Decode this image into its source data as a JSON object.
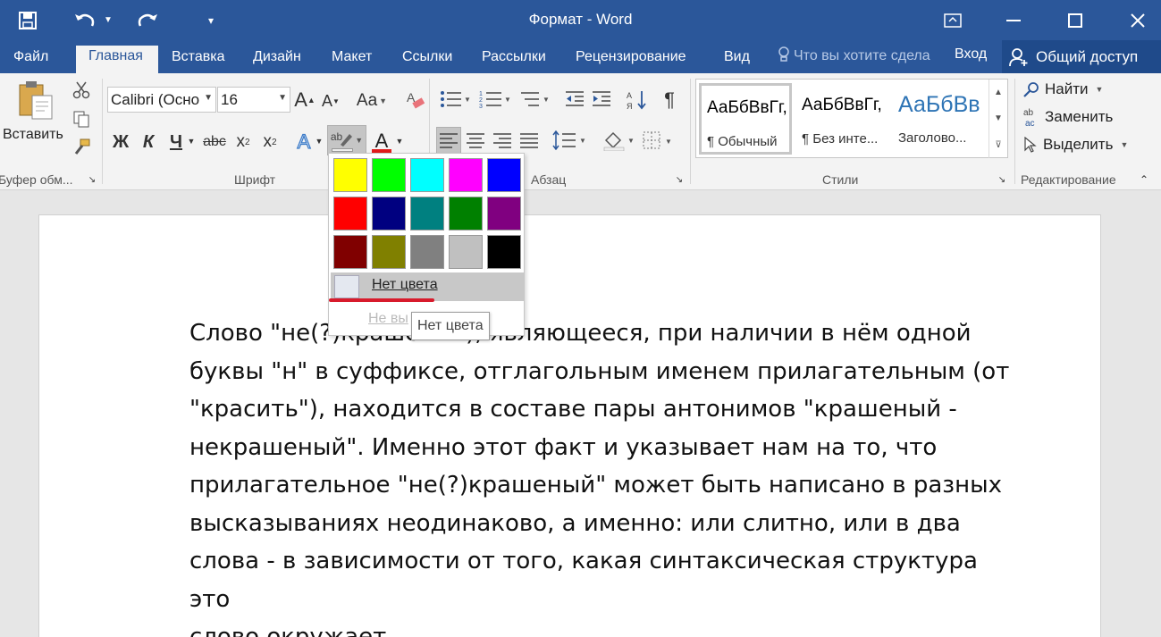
{
  "titlebar": {
    "title": "Формат - Word",
    "qat": [
      "save-icon",
      "undo-icon",
      "redo-icon",
      "customize-icon"
    ],
    "window_controls": [
      "ribbon-display-icon",
      "minimize-icon",
      "maximize-icon",
      "close-icon"
    ]
  },
  "menu": {
    "tabs": [
      "Файл",
      "Главная",
      "Вставка",
      "Дизайн",
      "Макет",
      "Ссылки",
      "Рассылки",
      "Рецензирование",
      "Вид"
    ],
    "active": "Главная",
    "tellme": "Что вы хотите сдела",
    "login": "Вход",
    "share": "Общий доступ"
  },
  "ribbon": {
    "clipboard": {
      "paste": "Вставить",
      "label": "Буфер обм..."
    },
    "font": {
      "name": "Calibri (Осно",
      "size": "16",
      "bold": "Ж",
      "italic": "К",
      "underline": "Ч",
      "strike": "abc",
      "subscript": "x",
      "sub_mark": "2",
      "superscript": "x",
      "sup_mark": "2",
      "grow": "A",
      "shrink": "A",
      "case": "Aa",
      "font_color": "A",
      "text_effects": "A",
      "highlight": "ab",
      "label": "Шрифт"
    },
    "paragraph": {
      "label": "Абзац",
      "pilcrow": "¶"
    },
    "styles": {
      "items": [
        {
          "sample": "АаБбВвГг,",
          "name": "¶ Обычный"
        },
        {
          "sample": "АаБбВвГг,",
          "name": "¶ Без инте..."
        },
        {
          "sample": "АаБбВв",
          "name": "Заголово..."
        }
      ],
      "label": "Стили"
    },
    "editing": {
      "find": "Найти",
      "replace": "Заменить",
      "select": "Выделить",
      "label": "Редактирование"
    }
  },
  "highlight_dropdown": {
    "colors": [
      "#ffff00",
      "#00ff00",
      "#00ffff",
      "#ff00ff",
      "#0000ff",
      "#ff0000",
      "#000080",
      "#008080",
      "#008000",
      "#800080",
      "#800000",
      "#808000",
      "#808080",
      "#c0c0c0",
      "#000000"
    ],
    "no_color": "Нет цвета",
    "stop": "Не вы",
    "tooltip": "Нет цвета"
  },
  "document": {
    "lines": [
      "Слово \"не(?)краше",
      "буквы \"н\" в суффиксе, отглагольным именем прилагательным (от",
      "\"красить\"), находится в составе пары антонимов \"крашеный -",
      "некрашеный\". Именно этот факт и указывает нам на то, что",
      "прилагательное \"не(?)крашеный\" может быть написано в разных",
      "высказываниях неодинаково, а именно: или слитно, или в два",
      "слова - в зависимости от того, какая синтаксическая структура это",
      "слово окружает."
    ],
    "line1_tail": "), являющееся, при наличии в нём одной"
  }
}
